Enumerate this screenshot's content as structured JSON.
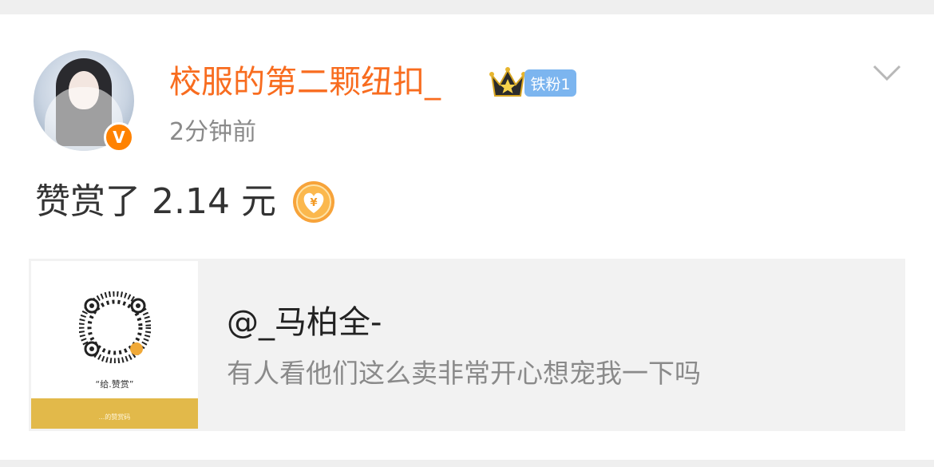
{
  "post": {
    "author": "校服的第二颗纽扣_",
    "fan_badge": "铁粉1",
    "time": "2分钟前",
    "verified_mark": "V",
    "reward_text": "赞赏了 2.14 元",
    "reward_symbol": "¥"
  },
  "card": {
    "title": "@_马柏全-",
    "description": "有人看他们这么卖非常开心想宠我一下吗",
    "qr_caption": "“给.赞赏”",
    "qr_footer": "...的赞赏码"
  },
  "colors": {
    "username": "#f86c1f",
    "verified": "#ff8200",
    "fan_badge": "#7cb5ef",
    "coin": "#f7a33a",
    "qr_footer": "#e2b94a"
  },
  "icons": [
    "avatar",
    "verified-icon",
    "crown-icon",
    "chevron-down-icon",
    "coin-icon",
    "qr-code"
  ]
}
